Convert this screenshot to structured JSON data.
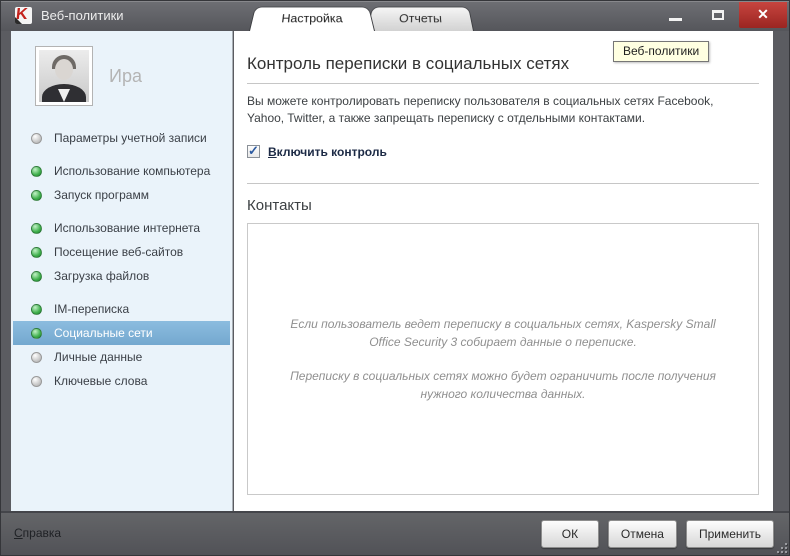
{
  "window": {
    "title": "Веб-политики"
  },
  "icons": {
    "close": "✕",
    "check": "✓",
    "app": "kaspersky-logo",
    "app_letter": "K"
  },
  "tabs": [
    {
      "label": "Настройка",
      "active": true
    },
    {
      "label": "Отчеты",
      "active": false
    }
  ],
  "sidebar": {
    "user": {
      "name": "Ира"
    },
    "groups": [
      {
        "items": [
          {
            "label": "Параметры учетной записи",
            "status": "gray",
            "selected": false
          }
        ]
      },
      {
        "items": [
          {
            "label": "Использование компьютера",
            "status": "green",
            "selected": false
          },
          {
            "label": "Запуск программ",
            "status": "green",
            "selected": false
          }
        ]
      },
      {
        "items": [
          {
            "label": "Использование интернета",
            "status": "green",
            "selected": false
          },
          {
            "label": "Посещение веб-сайтов",
            "status": "green",
            "selected": false
          },
          {
            "label": "Загрузка файлов",
            "status": "green",
            "selected": false
          }
        ]
      },
      {
        "items": [
          {
            "label": "IM-переписка",
            "status": "green",
            "selected": false
          },
          {
            "label": "Социальные сети",
            "status": "green",
            "selected": true
          },
          {
            "label": "Личные данные",
            "status": "gray",
            "selected": false
          },
          {
            "label": "Ключевые слова",
            "status": "gray",
            "selected": false
          }
        ]
      }
    ]
  },
  "main": {
    "tooltip": "Веб-политики",
    "title": "Контроль переписки в социальных сетях",
    "description": "Вы можете контролировать переписку пользователя в социальных сетях Facebook, Yahoo, Twitter, а также запрещать переписку с отдельными контактами.",
    "checkbox": {
      "label_mnemonic": "В",
      "label_rest": "ключить контроль",
      "checked": true
    },
    "contacts": {
      "title": "Контакты",
      "empty_text_1": "Если пользователь ведет переписку в социальных сетях, Kaspersky Small Office Security 3 собирает данные о переписке.",
      "empty_text_2": "Переписку в социальных сетях можно будет ограничить после получения нужного количества данных."
    }
  },
  "footer": {
    "help_mnemonic": "С",
    "help_rest": "правка",
    "buttons": [
      "ОК",
      "Отмена",
      "Применить"
    ]
  },
  "colors": {
    "titlebar": "#5b5c61",
    "close_button": "#b02c28",
    "sidebar_bg": "#eaf3fa",
    "selected_item_bg": "#7fb0d5",
    "status_green": "#3cae49",
    "status_gray": "#c7c7c7",
    "tooltip_bg": "#ffffe1",
    "checkbox_check": "#2c5aa0",
    "empty_text": "#8f8f8f"
  }
}
